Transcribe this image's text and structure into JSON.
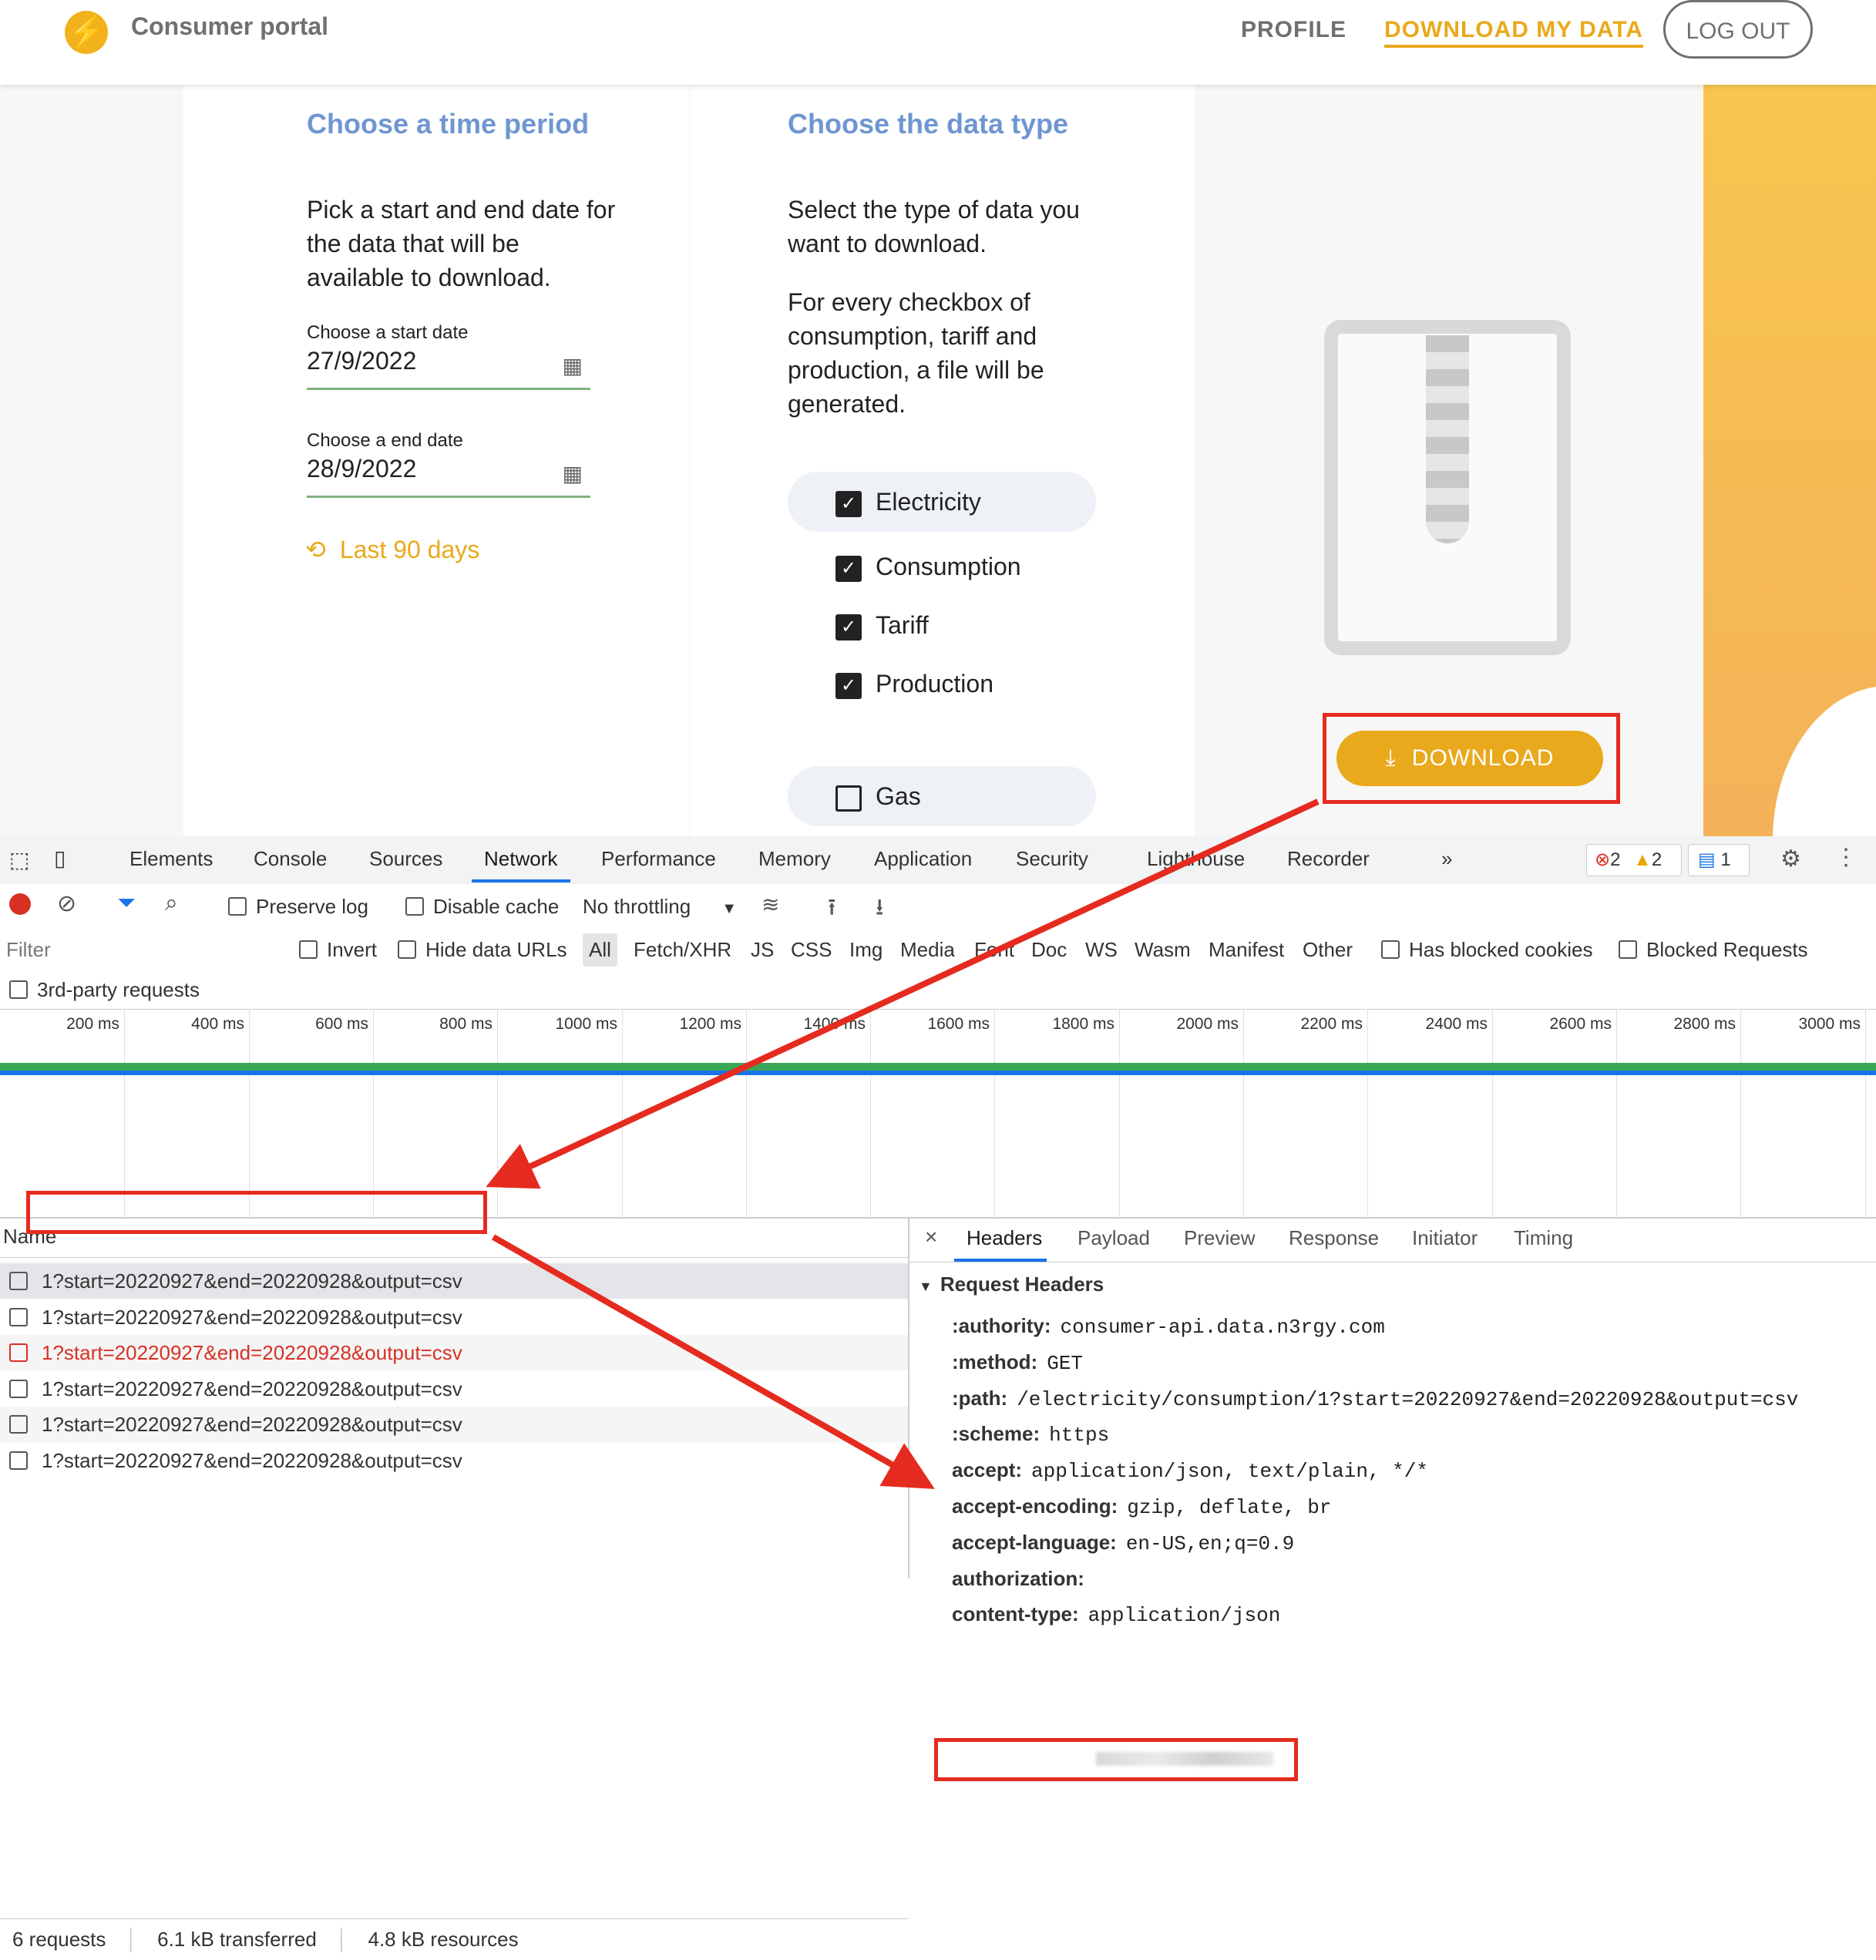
{
  "header": {
    "brand": "Consumer portal",
    "nav": [
      "PROFILE",
      "DOWNLOAD MY DATA"
    ],
    "logout": "LOG OUT"
  },
  "time_period": {
    "title": "Choose a time period",
    "description": "Pick a start and end date for the data that will be available to download.",
    "start_label": "Choose a start date",
    "start_value": "27/9/2022",
    "end_label": "Choose a end date",
    "end_value": "28/9/2022",
    "preset": "Last 90 days"
  },
  "data_type": {
    "title": "Choose the data type",
    "description1": "Select the type of data you want to download.",
    "description2": "For every checkbox of consumption, tariff and production, a file will be generated.",
    "options": [
      {
        "label": "Electricity",
        "checked": true
      },
      {
        "label": "Consumption",
        "checked": true
      },
      {
        "label": "Tariff",
        "checked": true
      },
      {
        "label": "Production",
        "checked": true
      },
      {
        "label": "Gas",
        "checked": false
      }
    ]
  },
  "download": {
    "label": "DOWNLOAD"
  },
  "devtools": {
    "tabs": [
      "Elements",
      "Console",
      "Sources",
      "Network",
      "Performance",
      "Memory",
      "Application",
      "Security",
      "Lighthouse",
      "Recorder",
      "»"
    ],
    "active_tab": "Network",
    "badges": {
      "errors": "2",
      "warnings": "2",
      "messages": "1"
    },
    "toolbar": {
      "preserve_log": "Preserve log",
      "disable_cache": "Disable cache",
      "throttling": "No throttling"
    },
    "filter": {
      "placeholder": "Filter",
      "invert": "Invert",
      "hide_data_urls": "Hide data URLs",
      "types": [
        "All",
        "Fetch/XHR",
        "JS",
        "CSS",
        "Img",
        "Media",
        "Font",
        "Doc",
        "WS",
        "Wasm",
        "Manifest",
        "Other"
      ],
      "has_blocked_cookies": "Has blocked cookies",
      "blocked_requests": "Blocked Requests",
      "third_party": "3rd-party requests"
    },
    "timeline_ticks": [
      "200 ms",
      "400 ms",
      "600 ms",
      "800 ms",
      "1000 ms",
      "1200 ms",
      "1400 ms",
      "1600 ms",
      "1800 ms",
      "2000 ms",
      "2200 ms",
      "2400 ms",
      "2600 ms",
      "2800 ms",
      "3000 ms"
    ],
    "name_header": "Name",
    "requests": [
      {
        "name": "1?start=20220927&end=20220928&output=csv",
        "error": false
      },
      {
        "name": "1?start=20220927&end=20220928&output=csv",
        "error": false
      },
      {
        "name": "1?start=20220927&end=20220928&output=csv",
        "error": true
      },
      {
        "name": "1?start=20220927&end=20220928&output=csv",
        "error": false
      },
      {
        "name": "1?start=20220927&end=20220928&output=csv",
        "error": false
      },
      {
        "name": "1?start=20220927&end=20220928&output=csv",
        "error": false
      }
    ],
    "status": [
      "6 requests",
      "6.1 kB transferred",
      "4.8 kB resources"
    ],
    "detail_tabs": [
      "Headers",
      "Payload",
      "Preview",
      "Response",
      "Initiator",
      "Timing"
    ],
    "section": "Request Headers",
    "headers": [
      {
        "k": ":authority:",
        "v": "consumer-api.data.n3rgy.com"
      },
      {
        "k": ":method:",
        "v": "GET"
      },
      {
        "k": ":path:",
        "v": "/electricity/consumption/1?start=20220927&end=20220928&output=csv"
      },
      {
        "k": ":scheme:",
        "v": "https"
      },
      {
        "k": "accept:",
        "v": "application/json, text/plain, */*"
      },
      {
        "k": "accept-encoding:",
        "v": "gzip, deflate, br"
      },
      {
        "k": "accept-language:",
        "v": "en-US,en;q=0.9"
      },
      {
        "k": "authorization:",
        "v": ""
      },
      {
        "k": "content-type:",
        "v": "application/json"
      }
    ]
  },
  "colors": {
    "accent": "#e9a91c",
    "title_blue": "#6f96d1",
    "highlight_red": "#e52b1f",
    "devtools_blue": "#1a73e8"
  }
}
